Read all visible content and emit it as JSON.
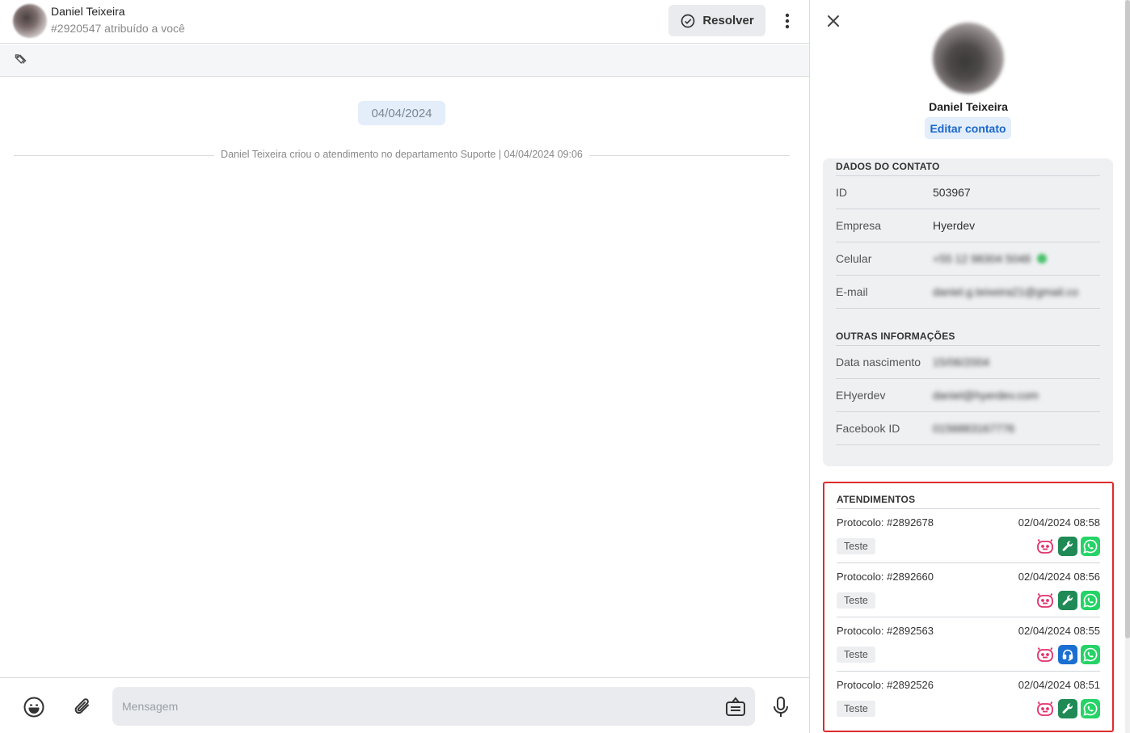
{
  "header": {
    "contact_name": "Daniel Teixeira",
    "subtitle": "#2920547 atribuído a você",
    "resolve_label": "Resolver"
  },
  "chat": {
    "date_chip": "04/04/2024",
    "system_message": "Daniel Teixeira criou o atendimento no departamento Suporte | 04/04/2024 09:06"
  },
  "composer": {
    "placeholder": "Mensagem",
    "value": ""
  },
  "contact_panel": {
    "name": "Daniel Teixeira",
    "edit_label": "Editar contato",
    "dados_title": "DADOS DO CONTATO",
    "dados": [
      {
        "label": "ID",
        "value": "503967",
        "obscured": false
      },
      {
        "label": "Empresa",
        "value": "Hyerdev",
        "obscured": false
      },
      {
        "label": "Celular",
        "value": "+55 12 98304 5048",
        "obscured": true
      },
      {
        "label": "E-mail",
        "value": "daniel.g.teixeira21@gmail.co",
        "obscured": true
      }
    ],
    "outras_title": "OUTRAS INFORMAÇÕES",
    "outras": [
      {
        "label": "Data nascimento",
        "value": "15/06/2004",
        "obscured": true
      },
      {
        "label": "EHyerdev",
        "value": "daniel@hyerdev.com",
        "obscured": true
      },
      {
        "label": "Facebook ID",
        "value": "0156883167776",
        "obscured": true
      }
    ],
    "atendimentos_title": "ATENDIMENTOS",
    "atendimentos": [
      {
        "protocolo": "Protocolo: #2892678",
        "datetime": "02/04/2024 08:58",
        "department": "Teste",
        "agent_icon": "wrench-icon"
      },
      {
        "protocolo": "Protocolo: #2892660",
        "datetime": "02/04/2024 08:56",
        "department": "Teste",
        "agent_icon": "wrench-icon"
      },
      {
        "protocolo": "Protocolo: #2892563",
        "datetime": "02/04/2024 08:55",
        "department": "Teste",
        "agent_icon": "headset-icon"
      },
      {
        "protocolo": "Protocolo: #2892526",
        "datetime": "02/04/2024 08:51",
        "department": "Teste",
        "agent_icon": "wrench-icon"
      }
    ]
  },
  "colors": {
    "accent_blue": "#1a66c9",
    "chip_bg": "#e3eefa",
    "bot_pink": "#e0306d",
    "tool_green": "#1f8a55",
    "headset_blue": "#1a6fd1",
    "whatsapp_green": "#25d366",
    "highlight_red": "#e02b2b"
  }
}
